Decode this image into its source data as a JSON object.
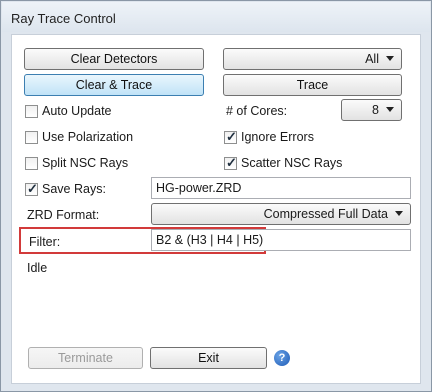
{
  "window": {
    "title": "Ray Trace Control"
  },
  "buttons": {
    "clear_detectors": "Clear Detectors",
    "clear_trace": "Clear & Trace",
    "trace": "Trace",
    "terminate": "Terminate",
    "exit": "Exit"
  },
  "detector_select": {
    "value": "All"
  },
  "cores": {
    "label": "# of Cores:",
    "value": "8"
  },
  "options": {
    "auto_update": {
      "label": "Auto Update",
      "checked": false
    },
    "use_polarization": {
      "label": "Use Polarization",
      "checked": false
    },
    "split_nsc_rays": {
      "label": "Split NSC Rays",
      "checked": false
    },
    "ignore_errors": {
      "label": "Ignore Errors",
      "checked": true
    },
    "scatter_nsc_rays": {
      "label": "Scatter NSC Rays",
      "checked": true
    },
    "save_rays": {
      "label": "Save Rays:",
      "checked": true
    }
  },
  "save_rays_file": "HG-power.ZRD",
  "zrd_format": {
    "label": "ZRD Format:",
    "value": "Compressed Full Data"
  },
  "filter": {
    "label": "Filter:",
    "value": "B2 & (H3 | H4 | H5)"
  },
  "status": "Idle",
  "colors": {
    "highlight": "#d23a3a",
    "panel_bg": "#ffffff",
    "window_bg": "#dfe6ee"
  },
  "icons": {
    "help": "help-icon",
    "check": "checkmark-icon",
    "dropdown": "chevron-down-icon"
  }
}
